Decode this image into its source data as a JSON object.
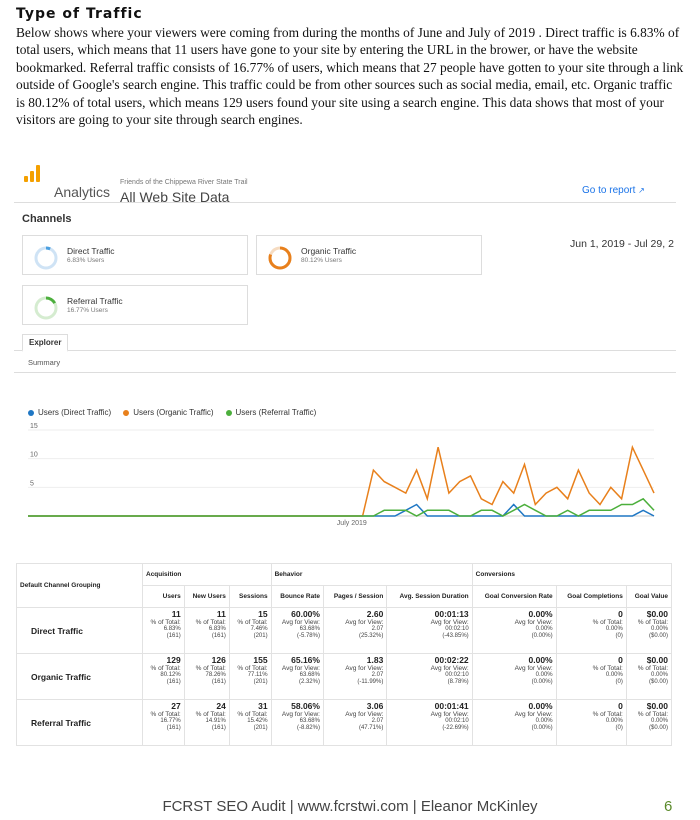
{
  "heading": "Type of Traffic",
  "intro": "Below shows where your viewers were coming from during the months of June and July of 2019 . Direct traffic is 6.83% of total users, which means that 11 users have gone to your site by entering the URL in the brower, or have the website bookmarked. Referral traffic consists of 16.77% of users, which means that 27 people have gotten to your site through a link outside of Google's search engine. This traffic could be from other sources such as social media, email, etc. Organic traffic is 80.12% of total users, which means 129 users found your site using a search engine. This data shows that most of your visitors are going to your site through search engines.",
  "ga": {
    "app_name": "Analytics",
    "account": "Friends of the Chippewa River State Trail",
    "property": "All Web Site Data",
    "go_to_report": "Go to report",
    "section_title": "Channels",
    "date_range": "Jun 1, 2019 - Jul 29, 2",
    "cards": [
      {
        "name": "Direct Traffic",
        "sub": "6.83% Users",
        "pct": 6.83,
        "color": "#4a9fe0"
      },
      {
        "name": "Organic Traffic",
        "sub": "80.12% Users",
        "pct": 80.12,
        "color": "#e8801c"
      },
      {
        "name": "Referral Traffic",
        "sub": "16.77% Users",
        "pct": 16.77,
        "color": "#4caf3c"
      }
    ],
    "tab_explorer": "Explorer",
    "tab_summary": "Summary"
  },
  "chart_data": {
    "type": "line",
    "xlabel": "",
    "ylabel": "",
    "x_tick_labels": [
      "July 2019"
    ],
    "y_ticks": [
      5,
      10,
      15
    ],
    "ylim": [
      0,
      15
    ],
    "x_days": 59,
    "series": [
      {
        "name": "Users (Direct Traffic)",
        "color": "#1f77c4",
        "values": [
          0,
          0,
          0,
          0,
          0,
          0,
          0,
          0,
          0,
          0,
          0,
          0,
          0,
          0,
          0,
          0,
          0,
          0,
          0,
          0,
          0,
          0,
          0,
          0,
          0,
          0,
          0,
          0,
          0,
          0,
          0,
          0,
          0,
          0,
          0,
          1,
          2,
          0,
          0,
          0,
          0,
          0,
          0,
          0,
          0,
          2,
          0,
          0,
          0,
          0,
          0,
          0,
          0,
          0,
          0,
          0,
          0,
          1,
          0
        ]
      },
      {
        "name": "Users (Organic Traffic)",
        "color": "#e8801c",
        "values": [
          0,
          0,
          0,
          0,
          0,
          0,
          0,
          0,
          0,
          0,
          0,
          0,
          0,
          0,
          0,
          0,
          0,
          0,
          0,
          0,
          0,
          0,
          0,
          0,
          0,
          0,
          0,
          0,
          0,
          0,
          0,
          0,
          8,
          6,
          5,
          4,
          8,
          3,
          12,
          4,
          6,
          7,
          3,
          2,
          6,
          4,
          9,
          2,
          4,
          5,
          3,
          8,
          4,
          2,
          5,
          3,
          12,
          8,
          4
        ]
      },
      {
        "name": "Users (Referral Traffic)",
        "color": "#4caf3c",
        "values": [
          0,
          0,
          0,
          0,
          0,
          0,
          0,
          0,
          0,
          0,
          0,
          0,
          0,
          0,
          0,
          0,
          0,
          0,
          0,
          0,
          0,
          0,
          0,
          0,
          0,
          0,
          0,
          0,
          0,
          0,
          0,
          0,
          0,
          1,
          1,
          1,
          0,
          1,
          1,
          1,
          0,
          0,
          1,
          1,
          0,
          1,
          2,
          1,
          0,
          0,
          1,
          0,
          1,
          1,
          1,
          2,
          2,
          3,
          1
        ]
      }
    ]
  },
  "table": {
    "group_header": "Default Channel Grouping",
    "sections": [
      "Acquisition",
      "Behavior",
      "Conversions"
    ],
    "columns": [
      "Users",
      "New Users",
      "Sessions",
      "Bounce Rate",
      "Pages / Session",
      "Avg. Session Duration",
      "Goal Conversion Rate",
      "Goal Completions",
      "Goal Value"
    ],
    "rows": [
      {
        "label": "Direct Traffic",
        "cells": [
          {
            "v": "11",
            "l": "% of Total:",
            "s1": "6.83%",
            "s2": "(161)"
          },
          {
            "v": "11",
            "l": "% of Total:",
            "s1": "6.83%",
            "s2": "(161)"
          },
          {
            "v": "15",
            "l": "% of Total:",
            "s1": "7.46%",
            "s2": "(201)"
          },
          {
            "v": "60.00%",
            "l": "Avg for View:",
            "s1": "63.68%",
            "s2": "(-5.78%)"
          },
          {
            "v": "2.60",
            "l": "Avg for View:",
            "s1": "2.07",
            "s2": "(25.32%)"
          },
          {
            "v": "00:01:13",
            "l": "Avg for View:",
            "s1": "00:02:10",
            "s2": "(-43.85%)"
          },
          {
            "v": "0.00%",
            "l": "Avg for View:",
            "s1": "0.00%",
            "s2": "(0.00%)"
          },
          {
            "v": "0",
            "l": "% of Total:",
            "s1": "0.00%",
            "s2": "(0)"
          },
          {
            "v": "$0.00",
            "l": "% of Total:",
            "s1": "0.00%",
            "s2": "($0.00)"
          }
        ]
      },
      {
        "label": "Organic Traffic",
        "cells": [
          {
            "v": "129",
            "l": "% of Total:",
            "s1": "80.12%",
            "s2": "(161)"
          },
          {
            "v": "126",
            "l": "% of Total:",
            "s1": "78.26%",
            "s2": "(161)"
          },
          {
            "v": "155",
            "l": "% of Total:",
            "s1": "77.11%",
            "s2": "(201)"
          },
          {
            "v": "65.16%",
            "l": "Avg for View:",
            "s1": "63.68%",
            "s2": "(2.32%)"
          },
          {
            "v": "1.83",
            "l": "Avg for View:",
            "s1": "2.07",
            "s2": "(-11.99%)"
          },
          {
            "v": "00:02:22",
            "l": "Avg for View:",
            "s1": "00:02:10",
            "s2": "(8.78%)"
          },
          {
            "v": "0.00%",
            "l": "Avg for View:",
            "s1": "0.00%",
            "s2": "(0.00%)"
          },
          {
            "v": "0",
            "l": "% of Total:",
            "s1": "0.00%",
            "s2": "(0)"
          },
          {
            "v": "$0.00",
            "l": "% of Total:",
            "s1": "0.00%",
            "s2": "($0.00)"
          }
        ]
      },
      {
        "label": "Referral Traffic",
        "cells": [
          {
            "v": "27",
            "l": "% of Total:",
            "s1": "16.77%",
            "s2": "(161)"
          },
          {
            "v": "24",
            "l": "% of Total:",
            "s1": "14.91%",
            "s2": "(161)"
          },
          {
            "v": "31",
            "l": "% of Total:",
            "s1": "15.42%",
            "s2": "(201)"
          },
          {
            "v": "58.06%",
            "l": "Avg for View:",
            "s1": "63.68%",
            "s2": "(-8.82%)"
          },
          {
            "v": "3.06",
            "l": "Avg for View:",
            "s1": "2.07",
            "s2": "(47.71%)"
          },
          {
            "v": "00:01:41",
            "l": "Avg for View:",
            "s1": "00:02:10",
            "s2": "(-22.69%)"
          },
          {
            "v": "0.00%",
            "l": "Avg for View:",
            "s1": "0.00%",
            "s2": "(0.00%)"
          },
          {
            "v": "0",
            "l": "% of Total:",
            "s1": "0.00%",
            "s2": "(0)"
          },
          {
            "v": "$0.00",
            "l": "% of Total:",
            "s1": "0.00%",
            "s2": "($0.00)"
          }
        ]
      }
    ]
  },
  "footer": {
    "text": "FCRST SEO Audit | www.fcrstwi.com | Eleanor McKinley",
    "page": "6"
  }
}
